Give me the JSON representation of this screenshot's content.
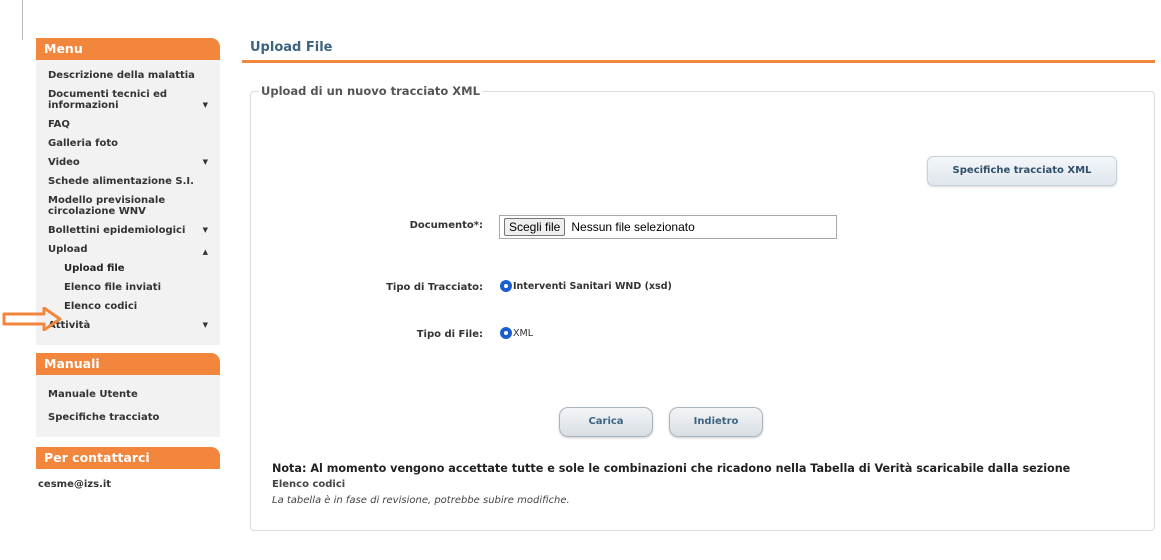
{
  "sidebar": {
    "menu_header": "Menu",
    "items": [
      {
        "label": "Descrizione della malattia",
        "caret": ""
      },
      {
        "label": "Documenti tecnici ed informazioni",
        "caret": "▼"
      },
      {
        "label": "FAQ",
        "caret": ""
      },
      {
        "label": "Galleria foto",
        "caret": ""
      },
      {
        "label": "Video",
        "caret": "▼"
      },
      {
        "label": "Schede alimentazione S.I.",
        "caret": ""
      },
      {
        "label": "Modello previsionale circolazione WNV",
        "caret": ""
      },
      {
        "label": "Bollettini epidemiologici",
        "caret": "▼"
      },
      {
        "label": "Upload",
        "caret": "▲"
      }
    ],
    "upload_sub": [
      {
        "label": "Upload file"
      },
      {
        "label": "Elenco file inviati"
      },
      {
        "label": "Elenco codici"
      }
    ],
    "attivita": {
      "label": "Attività",
      "caret": "▼"
    },
    "manuali_header": "Manuali",
    "manuali_items": [
      {
        "label": "Manuale Utente"
      },
      {
        "label": "Specifiche tracciato"
      }
    ],
    "contact_header": "Per contattarci",
    "contact_email": "cesme@izs.it"
  },
  "main": {
    "title": "Upload File",
    "legend": "Upload di un nuovo tracciato XML",
    "spec_button": "Specifiche tracciato XML",
    "documento_label": "Documento*:",
    "file_button": "Scegli file",
    "file_status": "Nessun file selezionato",
    "tipo_tracciato_label": "Tipo di Tracciato:",
    "tipo_tracciato_option": "Interventi Sanitari WND (xsd)",
    "tipo_file_label": "Tipo di File:",
    "tipo_file_option": "XML",
    "carica_button": "Carica",
    "indietro_button": "Indietro",
    "note_main": "Nota: Al momento vengono accettate tutte e sole le combinazioni che ricadono nella Tabella di Verità scaricabile dalla sezione",
    "note_link": "Elenco codici",
    "note_italic": "La tabella è in fase di revisione, potrebbe subire modifiche."
  },
  "colors": {
    "accent": "#f2863d",
    "title": "#3d6480",
    "radio": "#1a5fd0"
  }
}
